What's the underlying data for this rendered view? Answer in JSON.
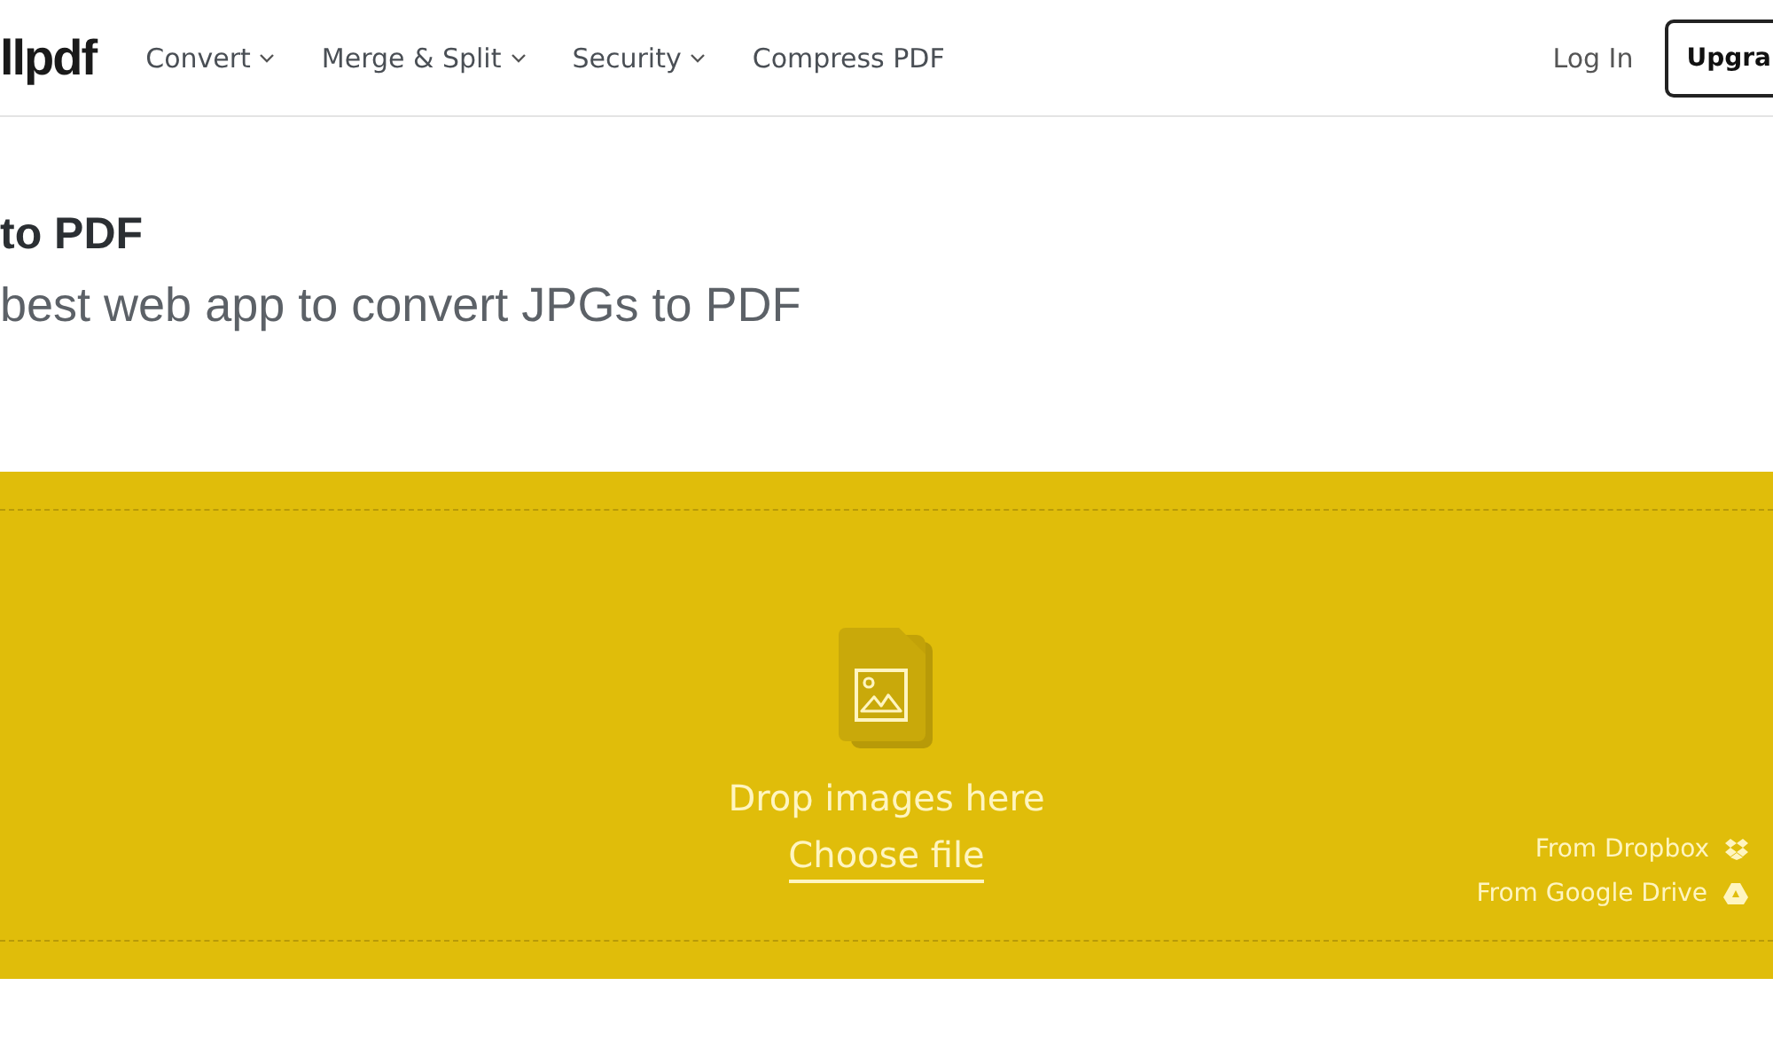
{
  "header": {
    "logo": "llpdf",
    "nav": [
      {
        "label": "Convert",
        "dropdown": true
      },
      {
        "label": "Merge & Split",
        "dropdown": true
      },
      {
        "label": "Security",
        "dropdown": true
      },
      {
        "label": "Compress PDF",
        "dropdown": false
      }
    ],
    "login": "Log In",
    "upgrade": "Upgra"
  },
  "title": "to PDF",
  "subtitle": "best web app to convert JPGs to PDF",
  "dropzone": {
    "prompt": "Drop images here",
    "choose": "Choose file",
    "sources": [
      {
        "label": "From Dropbox",
        "kind": "dropbox"
      },
      {
        "label": "From Google Drive",
        "kind": "drive"
      }
    ]
  }
}
